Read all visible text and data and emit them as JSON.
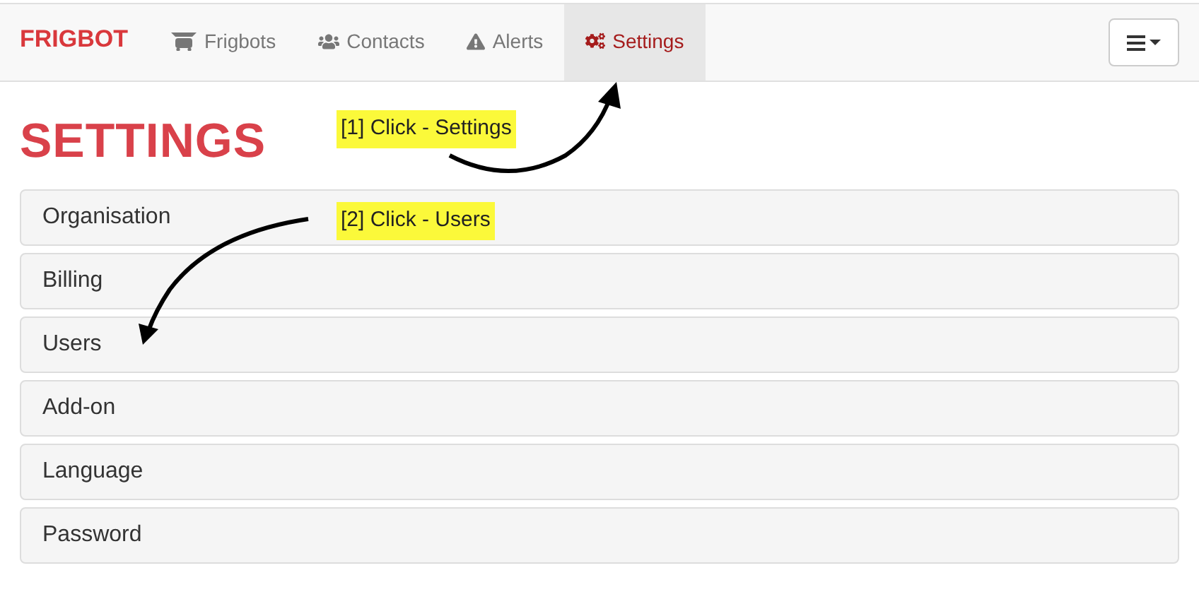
{
  "brand": "FRIGBOT",
  "nav": [
    {
      "label": "Frigbots",
      "kind": "frigbot",
      "selected": false
    },
    {
      "label": "Contacts",
      "kind": "users",
      "selected": false
    },
    {
      "label": "Alerts",
      "kind": "warning",
      "selected": false
    },
    {
      "label": "Settings",
      "kind": "cogs",
      "selected": true
    }
  ],
  "heading": "SETTINGS",
  "panels": [
    "Organisation",
    "Billing",
    "Users",
    "Add-on",
    "Language",
    "Password"
  ],
  "annotations": [
    {
      "label": "[1] Click - Settings"
    },
    {
      "label": "[2] Click - Users"
    }
  ]
}
